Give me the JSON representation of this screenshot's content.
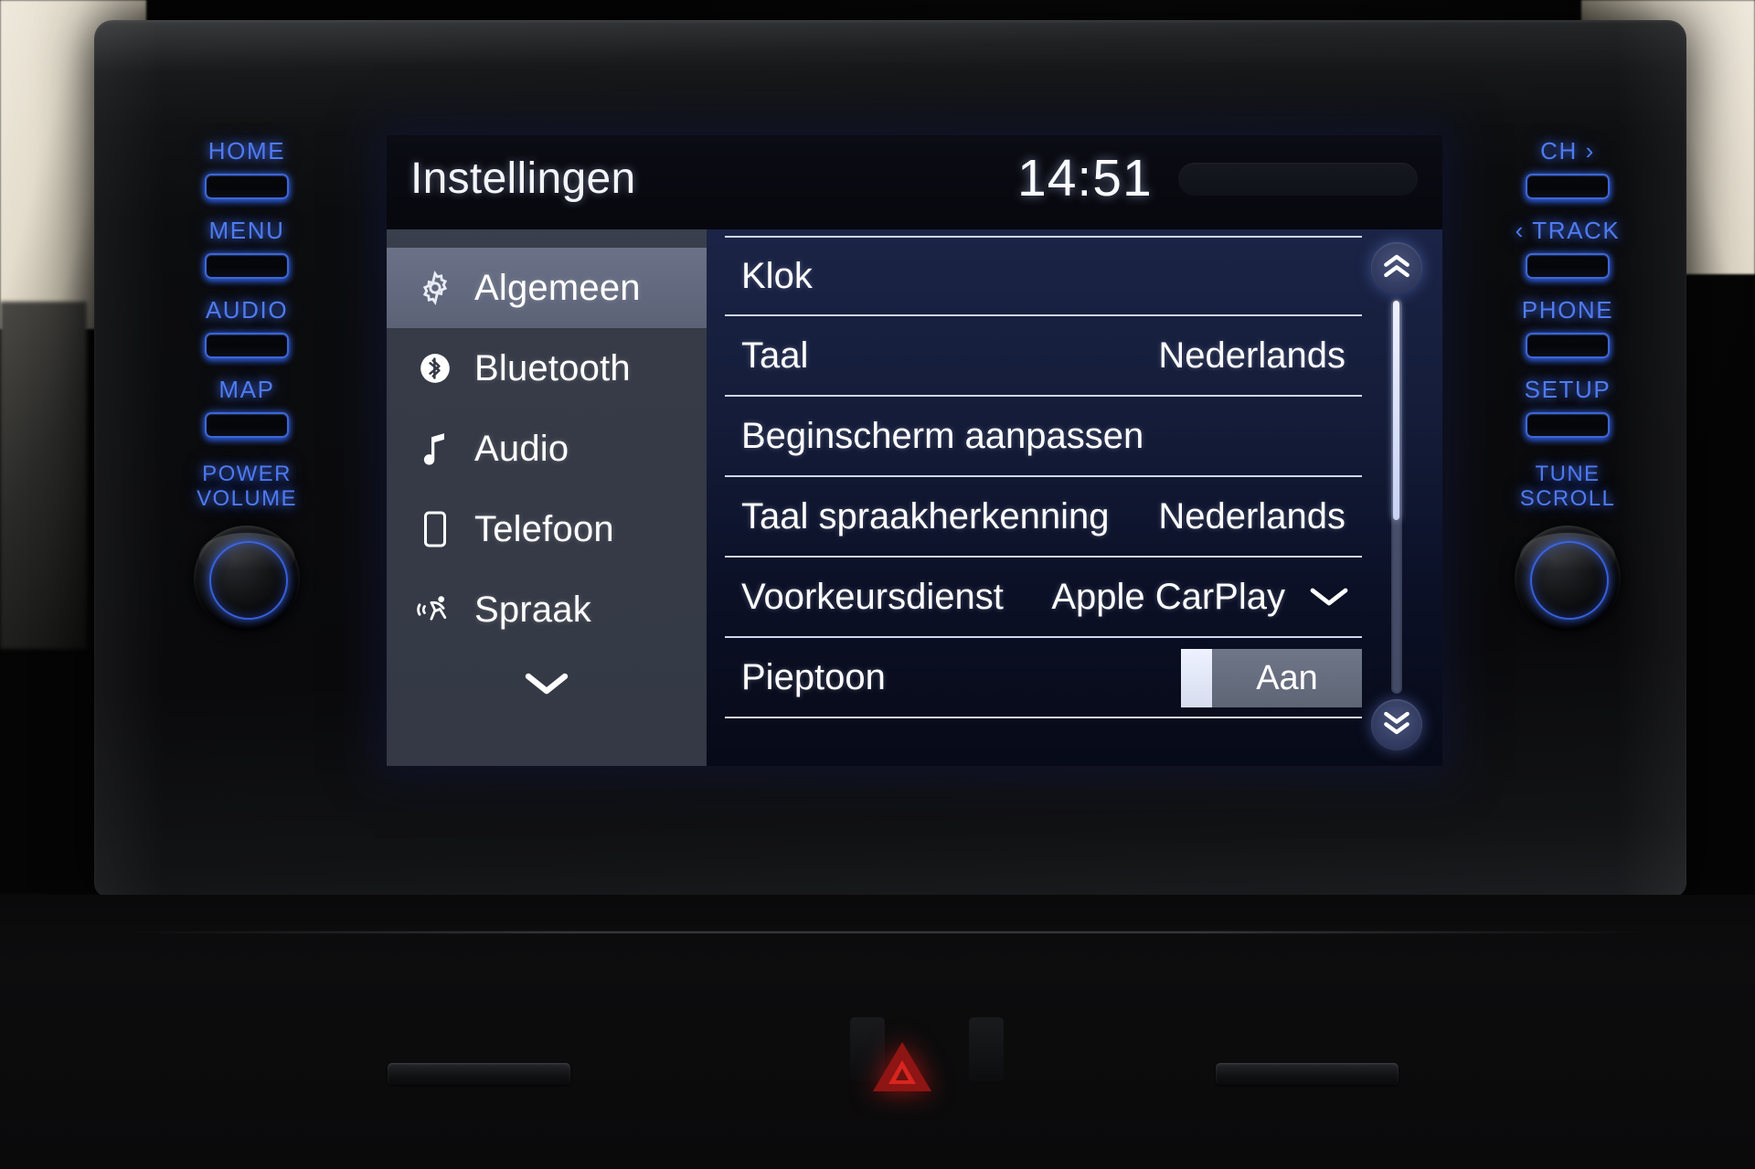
{
  "screen": {
    "title": "Instellingen",
    "clock": "14:51",
    "sidebar": {
      "items": [
        {
          "label": "Algemeen",
          "icon": "gear-icon",
          "active": true
        },
        {
          "label": "Bluetooth",
          "icon": "bluetooth-icon",
          "active": false
        },
        {
          "label": "Audio",
          "icon": "music-note-icon",
          "active": false
        },
        {
          "label": "Telefoon",
          "icon": "phone-icon",
          "active": false
        },
        {
          "label": "Spraak",
          "icon": "voice-icon",
          "active": false
        }
      ],
      "more_icon": "chevron-down-icon"
    },
    "settings_rows": [
      {
        "label": "Klok",
        "value": "",
        "type": "link"
      },
      {
        "label": "Taal",
        "value": "Nederlands",
        "type": "value"
      },
      {
        "label": "Beginscherm aanpassen",
        "value": "",
        "type": "link"
      },
      {
        "label": "Taal spraakherkenning",
        "value": "Nederlands",
        "type": "value"
      },
      {
        "label": "Voorkeursdienst",
        "value": "Apple CarPlay",
        "type": "dropdown"
      },
      {
        "label": "Pieptoon",
        "value": "Aan",
        "type": "toggle"
      }
    ],
    "scrollbar": {
      "up_icon": "double-chevron-up-icon",
      "down_icon": "double-chevron-down-icon"
    },
    "colors": {
      "accent_blue": "#4f7bf0",
      "list_bg": "#141c39",
      "sidebar_bg": "#363b47",
      "sidebar_active": "#636a7f",
      "row_divider": "#cfd6ef",
      "hazard_red": "#d8251f"
    }
  },
  "hardkeys": {
    "left": [
      {
        "label": "HOME"
      },
      {
        "label": "MENU"
      },
      {
        "label": "AUDIO"
      },
      {
        "label": "MAP"
      }
    ],
    "right": [
      {
        "label": "CH ›"
      },
      {
        "label": "‹ TRACK"
      },
      {
        "label": "PHONE"
      },
      {
        "label": "SETUP"
      }
    ],
    "left_knob": {
      "line1": "POWER",
      "line2": "VOLUME"
    },
    "right_knob": {
      "line1": "TUNE",
      "line2": "SCROLL"
    }
  },
  "console": {
    "hazard_icon": "hazard-triangle-icon"
  }
}
